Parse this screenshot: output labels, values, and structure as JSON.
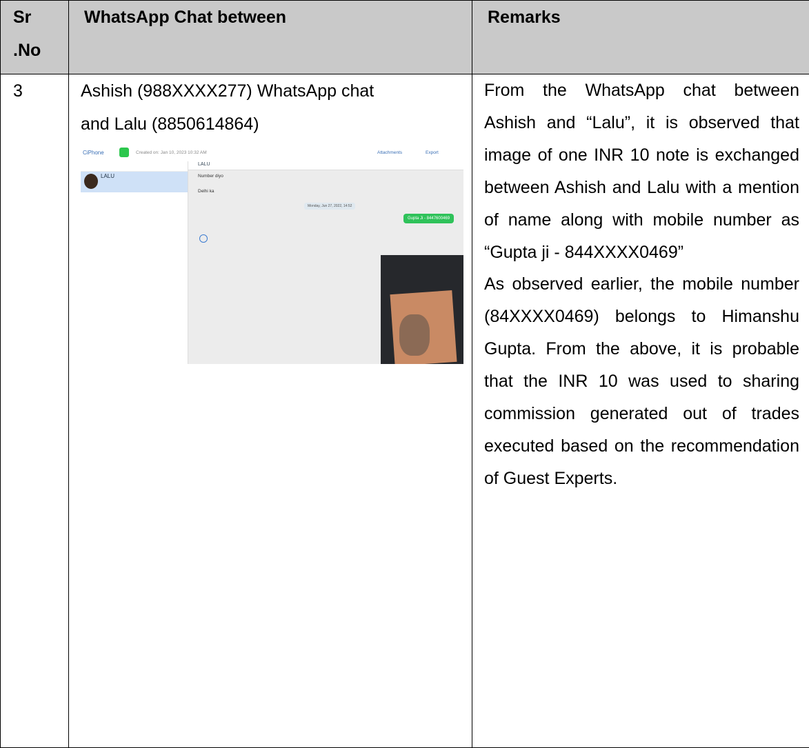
{
  "table": {
    "headers": {
      "sr_no_line1": "Sr",
      "sr_no_line2": ".No",
      "chat": "WhatsApp Chat between",
      "remarks": "Remarks"
    },
    "row": {
      "sr_no": "3",
      "chat_title_line1": "Ashish (988XXXX277) WhatsApp chat",
      "chat_title_line2": "and Lalu (8850614864)",
      "remarks_para1": "From the WhatsApp chat between Ashish and “Lalu”, it is observed that image of one INR 10 note is exchanged between Ashish and Lalu with a mention of name along with mobile number as “Gupta ji - 844XXXX0469”",
      "remarks_para2": "As observed earlier, the mobile number (84XXXX0469) belongs to Himanshu Gupta. From the above, it is probable that the INR 10 was used to sharing commission generated out of trades executed based on the recommendation of Guest Experts."
    }
  },
  "screenshot": {
    "app_menu": "CiPhone",
    "created_text": "Created on: Jan 10, 2023 10:32 AM",
    "attachments": "Attachments",
    "export": "Export",
    "contact_name": "LALU",
    "chat_header": "LALU",
    "msg1": "Number diyo",
    "msg2": "Delhi ka",
    "date_pill": "Monday, Jun 27, 2022, 14:52",
    "outgoing": "Gupta Ji - 8447600469"
  }
}
